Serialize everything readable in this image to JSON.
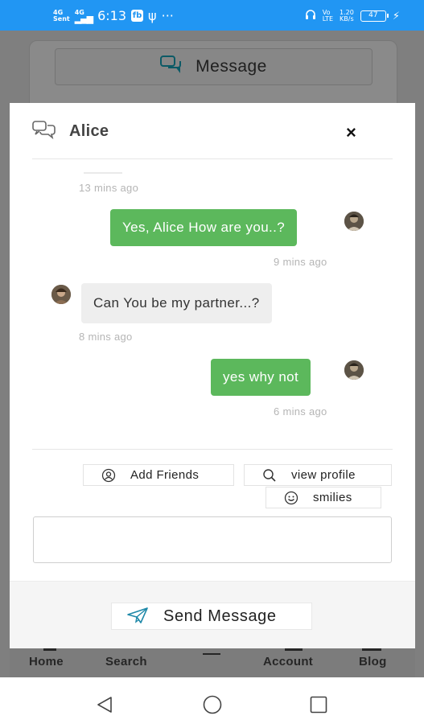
{
  "status_bar": {
    "network_1_top": "4G",
    "network_1_bottom": "Sent",
    "network_2_top": "4G",
    "time": "6:13",
    "app_icon": "fb",
    "usb_icon": "usb-icon",
    "more": "···",
    "speed_top": "1.20",
    "speed_bottom": "KB/s",
    "volte_top": "Vo",
    "volte_bottom": "LTE",
    "battery": "47"
  },
  "background": {
    "message_button_label": "Message"
  },
  "modal": {
    "title": "Alice",
    "close_label": "×",
    "messages": [
      {
        "direction": "in-truncated",
        "text": "",
        "time": "13 mins ago"
      },
      {
        "direction": "out",
        "text": "Yes, Alice How are you..?",
        "time": "9 mins ago"
      },
      {
        "direction": "in",
        "text": "Can You be my partner...?",
        "time": "8 mins ago"
      },
      {
        "direction": "out",
        "text": "yes why not",
        "time": "6 mins ago"
      }
    ],
    "actions": {
      "add_friends": "Add Friends",
      "view_profile": "view profile",
      "smilies": "smilies"
    },
    "input_value": "",
    "send_button": "Send Message"
  },
  "bottom_nav": {
    "items": [
      "Home",
      "Search",
      "",
      "Account",
      "Blog"
    ]
  },
  "colors": {
    "status_bar": "#2196f3",
    "outgoing_bubble": "#5cb85c",
    "incoming_bubble": "#eeeeee",
    "send_icon": "#1e88a8"
  }
}
